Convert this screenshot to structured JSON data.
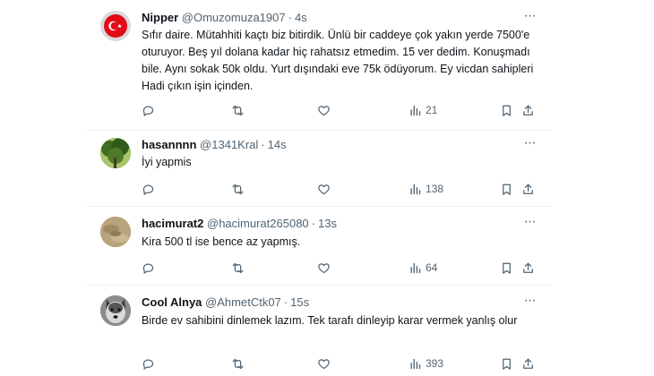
{
  "posts": [
    {
      "name": "Nipper",
      "handle": "@Omuzomuza1907",
      "time": "4s",
      "text": "Sıfır daire. Mütahhiti kaçtı biz bitirdik. Ünlü bir caddeye çok yakın yerde 7500'e oturuyor. Beş yıl dolana kadar hiç rahatsız etmedim. 15 ver dedim. Konuşmadı bile. Aynı sokak 50k oldu. Yurt dışındaki eve 75k ödüyorum. Ey vicdan sahipleri Hadi çıkın işin içinden.",
      "views": "21",
      "avatar": "turkish-flag"
    },
    {
      "name": "hasannnn",
      "handle": "@1341Kral",
      "time": "14s",
      "text": "İyi yapmis",
      "views": "138",
      "avatar": "tree"
    },
    {
      "name": "hacimurat2",
      "handle": "@hacimurat265080",
      "time": "13s",
      "text": "Kira 500 tl ise bence az yapmış.",
      "views": "64",
      "avatar": "sand"
    },
    {
      "name": "Cool Alnya",
      "handle": "@AhmetCtk07",
      "time": "15s",
      "text": "Birde ev sahibini dinlemek lazım. Tek tarafı dinleyip karar vermek yanlış olur",
      "views": "393",
      "avatar": "wolf"
    }
  ],
  "more_glyph": "···",
  "dot": "·"
}
